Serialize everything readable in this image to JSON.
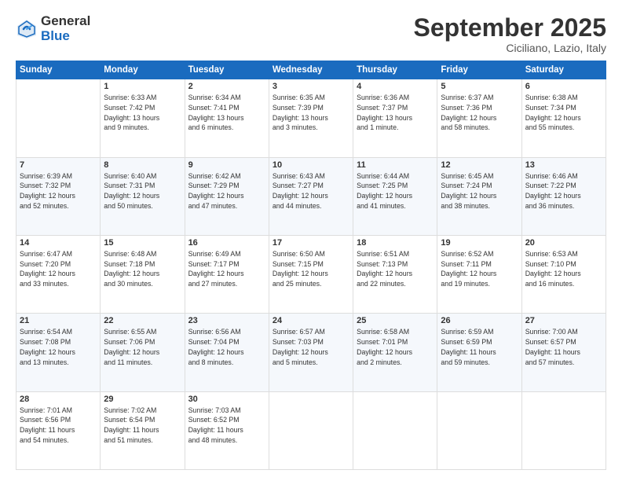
{
  "header": {
    "logo_general": "General",
    "logo_blue": "Blue",
    "month_title": "September 2025",
    "location": "Ciciliano, Lazio, Italy"
  },
  "weekdays": [
    "Sunday",
    "Monday",
    "Tuesday",
    "Wednesday",
    "Thursday",
    "Friday",
    "Saturday"
  ],
  "weeks": [
    [
      {
        "day": "",
        "info": ""
      },
      {
        "day": "1",
        "info": "Sunrise: 6:33 AM\nSunset: 7:42 PM\nDaylight: 13 hours\nand 9 minutes."
      },
      {
        "day": "2",
        "info": "Sunrise: 6:34 AM\nSunset: 7:41 PM\nDaylight: 13 hours\nand 6 minutes."
      },
      {
        "day": "3",
        "info": "Sunrise: 6:35 AM\nSunset: 7:39 PM\nDaylight: 13 hours\nand 3 minutes."
      },
      {
        "day": "4",
        "info": "Sunrise: 6:36 AM\nSunset: 7:37 PM\nDaylight: 13 hours\nand 1 minute."
      },
      {
        "day": "5",
        "info": "Sunrise: 6:37 AM\nSunset: 7:36 PM\nDaylight: 12 hours\nand 58 minutes."
      },
      {
        "day": "6",
        "info": "Sunrise: 6:38 AM\nSunset: 7:34 PM\nDaylight: 12 hours\nand 55 minutes."
      }
    ],
    [
      {
        "day": "7",
        "info": "Sunrise: 6:39 AM\nSunset: 7:32 PM\nDaylight: 12 hours\nand 52 minutes."
      },
      {
        "day": "8",
        "info": "Sunrise: 6:40 AM\nSunset: 7:31 PM\nDaylight: 12 hours\nand 50 minutes."
      },
      {
        "day": "9",
        "info": "Sunrise: 6:42 AM\nSunset: 7:29 PM\nDaylight: 12 hours\nand 47 minutes."
      },
      {
        "day": "10",
        "info": "Sunrise: 6:43 AM\nSunset: 7:27 PM\nDaylight: 12 hours\nand 44 minutes."
      },
      {
        "day": "11",
        "info": "Sunrise: 6:44 AM\nSunset: 7:25 PM\nDaylight: 12 hours\nand 41 minutes."
      },
      {
        "day": "12",
        "info": "Sunrise: 6:45 AM\nSunset: 7:24 PM\nDaylight: 12 hours\nand 38 minutes."
      },
      {
        "day": "13",
        "info": "Sunrise: 6:46 AM\nSunset: 7:22 PM\nDaylight: 12 hours\nand 36 minutes."
      }
    ],
    [
      {
        "day": "14",
        "info": "Sunrise: 6:47 AM\nSunset: 7:20 PM\nDaylight: 12 hours\nand 33 minutes."
      },
      {
        "day": "15",
        "info": "Sunrise: 6:48 AM\nSunset: 7:18 PM\nDaylight: 12 hours\nand 30 minutes."
      },
      {
        "day": "16",
        "info": "Sunrise: 6:49 AM\nSunset: 7:17 PM\nDaylight: 12 hours\nand 27 minutes."
      },
      {
        "day": "17",
        "info": "Sunrise: 6:50 AM\nSunset: 7:15 PM\nDaylight: 12 hours\nand 25 minutes."
      },
      {
        "day": "18",
        "info": "Sunrise: 6:51 AM\nSunset: 7:13 PM\nDaylight: 12 hours\nand 22 minutes."
      },
      {
        "day": "19",
        "info": "Sunrise: 6:52 AM\nSunset: 7:11 PM\nDaylight: 12 hours\nand 19 minutes."
      },
      {
        "day": "20",
        "info": "Sunrise: 6:53 AM\nSunset: 7:10 PM\nDaylight: 12 hours\nand 16 minutes."
      }
    ],
    [
      {
        "day": "21",
        "info": "Sunrise: 6:54 AM\nSunset: 7:08 PM\nDaylight: 12 hours\nand 13 minutes."
      },
      {
        "day": "22",
        "info": "Sunrise: 6:55 AM\nSunset: 7:06 PM\nDaylight: 12 hours\nand 11 minutes."
      },
      {
        "day": "23",
        "info": "Sunrise: 6:56 AM\nSunset: 7:04 PM\nDaylight: 12 hours\nand 8 minutes."
      },
      {
        "day": "24",
        "info": "Sunrise: 6:57 AM\nSunset: 7:03 PM\nDaylight: 12 hours\nand 5 minutes."
      },
      {
        "day": "25",
        "info": "Sunrise: 6:58 AM\nSunset: 7:01 PM\nDaylight: 12 hours\nand 2 minutes."
      },
      {
        "day": "26",
        "info": "Sunrise: 6:59 AM\nSunset: 6:59 PM\nDaylight: 11 hours\nand 59 minutes."
      },
      {
        "day": "27",
        "info": "Sunrise: 7:00 AM\nSunset: 6:57 PM\nDaylight: 11 hours\nand 57 minutes."
      }
    ],
    [
      {
        "day": "28",
        "info": "Sunrise: 7:01 AM\nSunset: 6:56 PM\nDaylight: 11 hours\nand 54 minutes."
      },
      {
        "day": "29",
        "info": "Sunrise: 7:02 AM\nSunset: 6:54 PM\nDaylight: 11 hours\nand 51 minutes."
      },
      {
        "day": "30",
        "info": "Sunrise: 7:03 AM\nSunset: 6:52 PM\nDaylight: 11 hours\nand 48 minutes."
      },
      {
        "day": "",
        "info": ""
      },
      {
        "day": "",
        "info": ""
      },
      {
        "day": "",
        "info": ""
      },
      {
        "day": "",
        "info": ""
      }
    ]
  ]
}
